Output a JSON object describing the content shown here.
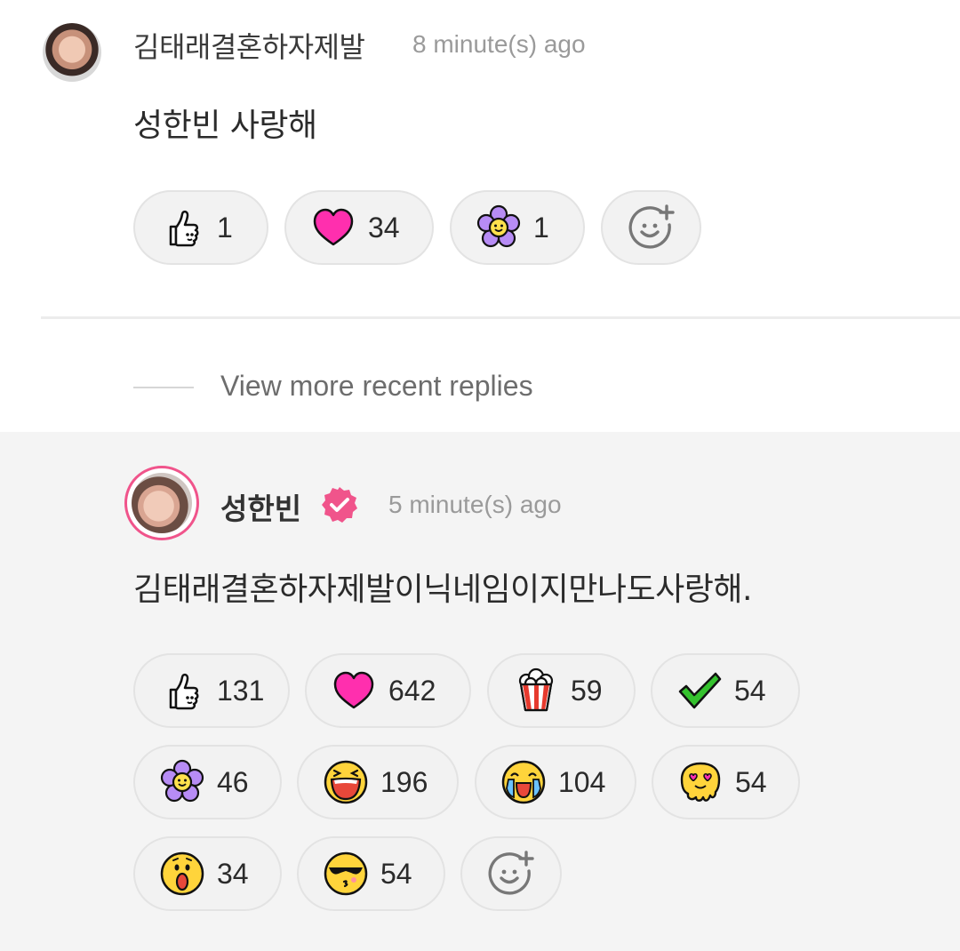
{
  "comment": {
    "username": "김태래결혼하자제발",
    "time": "8 minute(s) ago",
    "text": "성한빈 사랑해",
    "reactions": [
      {
        "icon": "thumbs-up-icon",
        "count": "1"
      },
      {
        "icon": "heart-icon",
        "count": "34"
      },
      {
        "icon": "purple-flower-icon",
        "count": "1"
      }
    ],
    "add_reaction_icon": "add-emoji-icon"
  },
  "view_more": "View more recent replies",
  "reply": {
    "username": "성한빈",
    "verified_icon": "verified-badge-icon",
    "time": "5 minute(s) ago",
    "text": "김태래결혼하자제발이닉네임이지만나도사랑해.",
    "reactions": [
      {
        "icon": "thumbs-up-icon",
        "count": "131"
      },
      {
        "icon": "heart-icon",
        "count": "642"
      },
      {
        "icon": "popcorn-icon",
        "count": "59"
      },
      {
        "icon": "check-icon",
        "count": "54"
      },
      {
        "icon": "purple-flower-icon",
        "count": "46"
      },
      {
        "icon": "laughing-face-icon",
        "count": "196"
      },
      {
        "icon": "crying-face-icon",
        "count": "104"
      },
      {
        "icon": "melting-heart-eyes-icon",
        "count": "54"
      },
      {
        "icon": "surprised-face-icon",
        "count": "34"
      },
      {
        "icon": "sunglasses-kiss-icon",
        "count": "54"
      }
    ],
    "add_reaction_icon": "add-emoji-icon"
  },
  "colors": {
    "accent_pink": "#f0548b",
    "heart": "#ff2fae",
    "pill_bg": "#f2f2f2",
    "reply_bg": "#f4f4f4"
  }
}
